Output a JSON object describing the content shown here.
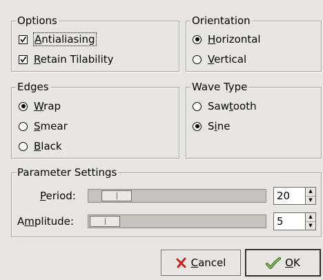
{
  "options": {
    "title": "Options",
    "antialiasing": {
      "label": "Antialiasing",
      "mnemonic": "A",
      "rest": "ntialiasing",
      "checked": true
    },
    "retain_tilability": {
      "label": "Retain Tilability",
      "mnemonic": "R",
      "rest": "etain Tilability",
      "checked": true
    }
  },
  "orientation": {
    "title": "Orientation",
    "horizontal": {
      "label": "Horizontal",
      "mnemonic": "H",
      "rest": "orizontal",
      "selected": true
    },
    "vertical": {
      "label": "Vertical",
      "mnemonic": "V",
      "rest": "ertical",
      "selected": false
    }
  },
  "edges": {
    "title": "Edges",
    "wrap": {
      "label": "Wrap",
      "mnemonic": "W",
      "rest": "rap",
      "selected": true
    },
    "smear": {
      "label": "Smear",
      "mnemonic": "S",
      "rest": "mear",
      "selected": false
    },
    "black": {
      "label": "Black",
      "mnemonic": "B",
      "rest": "lack",
      "selected": false
    }
  },
  "wave_type": {
    "title": "Wave Type",
    "sawtooth": {
      "label": "Sawtooth",
      "pre": "Saw",
      "mnemonic": "t",
      "rest": "ooth",
      "selected": false
    },
    "sine": {
      "label": "Sine",
      "pre": "S",
      "mnemonic": "i",
      "rest": "ne",
      "selected": true
    }
  },
  "parameters": {
    "title": "Parameter Settings",
    "period": {
      "mnemonic": "P",
      "rest": "eriod:",
      "value": "20",
      "slider_fraction": 0.08
    },
    "amplitude": {
      "pre": "A",
      "mnemonic": "m",
      "rest": "plitude:",
      "value": "5",
      "slider_fraction": 0.0
    }
  },
  "buttons": {
    "cancel": {
      "mnemonic": "C",
      "rest": "ancel",
      "icon": "red-x-icon"
    },
    "ok": {
      "mnemonic": "O",
      "rest": "K",
      "icon": "green-check-icon"
    }
  }
}
